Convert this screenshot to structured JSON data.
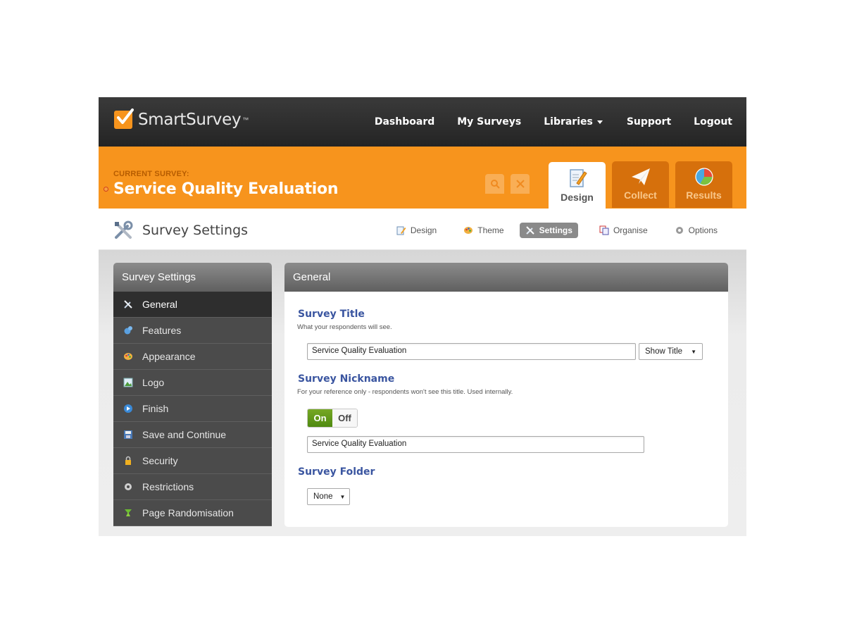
{
  "brand": {
    "name": "SmartSurvey",
    "tm": "™",
    "accent": "#f7941d"
  },
  "topnav": {
    "items": [
      {
        "label": "Dashboard"
      },
      {
        "label": "My Surveys"
      },
      {
        "label": "Libraries",
        "has_dropdown": true
      },
      {
        "label": "Support"
      },
      {
        "label": "Logout"
      }
    ]
  },
  "banner": {
    "current_label": "CURRENT SURVEY:",
    "survey_title": "Service Quality Evaluation",
    "tabs": [
      {
        "label": "Design",
        "icon": "pencil-doc-icon",
        "active": true
      },
      {
        "label": "Collect",
        "icon": "paper-plane-icon",
        "active": false
      },
      {
        "label": "Results",
        "icon": "pie-chart-icon",
        "active": false
      }
    ]
  },
  "subheader": {
    "title": "Survey Settings",
    "nav": [
      {
        "label": "Design",
        "icon": "pencil-icon"
      },
      {
        "label": "Theme",
        "icon": "palette-icon"
      },
      {
        "label": "Settings",
        "icon": "tools-icon",
        "active": true
      },
      {
        "label": "Organise",
        "icon": "pages-icon"
      },
      {
        "label": "Options",
        "icon": "gear-icon"
      }
    ]
  },
  "sidebar": {
    "title": "Survey Settings",
    "items": [
      {
        "label": "General",
        "icon": "tools-icon",
        "active": true
      },
      {
        "label": "Features",
        "icon": "features-icon"
      },
      {
        "label": "Appearance",
        "icon": "palette-icon"
      },
      {
        "label": "Logo",
        "icon": "image-icon"
      },
      {
        "label": "Finish",
        "icon": "finish-icon"
      },
      {
        "label": "Save and Continue",
        "icon": "floppy-icon"
      },
      {
        "label": "Security",
        "icon": "lock-icon"
      },
      {
        "label": "Restrictions",
        "icon": "gear-icon"
      },
      {
        "label": "Page Randomisation",
        "icon": "shuffle-icon"
      }
    ]
  },
  "panel": {
    "title": "General",
    "survey_title": {
      "label": "Survey Title",
      "help": "What your respondents will see.",
      "value": "Service Quality Evaluation",
      "display_option": "Show Title"
    },
    "survey_nickname": {
      "label": "Survey Nickname",
      "help": "For your reference only - respondents won't see this title. Used internally.",
      "toggle_on": "On",
      "toggle_off": "Off",
      "toggle_state": "On",
      "value": "Service Quality Evaluation"
    },
    "survey_folder": {
      "label": "Survey Folder",
      "value": "None"
    }
  }
}
